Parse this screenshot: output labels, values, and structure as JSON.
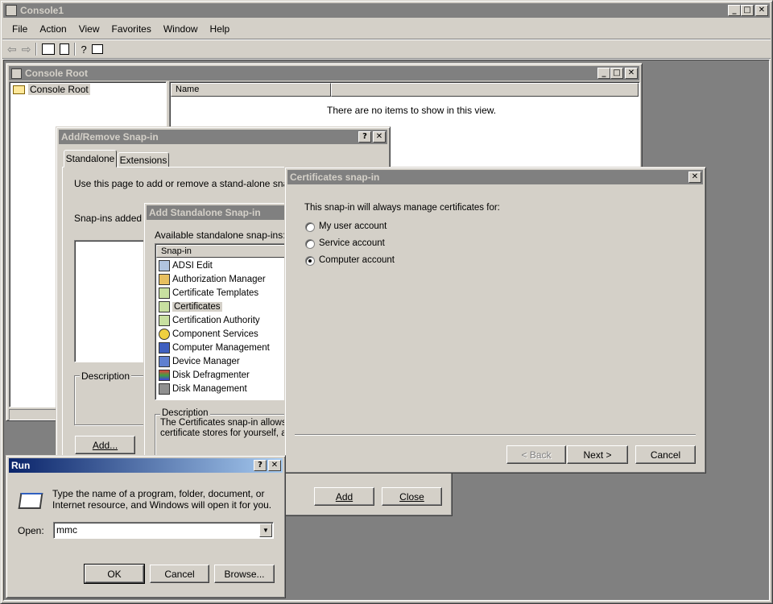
{
  "console": {
    "title": "Console1",
    "menu": [
      "File",
      "Action",
      "View",
      "Favorites",
      "Window",
      "Help"
    ]
  },
  "console_root": {
    "title": "Console Root",
    "tree_item": "Console Root",
    "column_name": "Name",
    "empty_message": "There are no items to show in this view."
  },
  "add_remove": {
    "title": "Add/Remove Snap-in",
    "tabs": [
      "Standalone",
      "Extensions"
    ],
    "instructions": "Use this page to add or remove a stand-alone snap-in",
    "snapins_added": "Snap-ins added to",
    "description_label": "Description",
    "add_button": "Add..."
  },
  "add_standalone": {
    "title": "Add Standalone Snap-in",
    "available_label": "Available standalone snap-ins:",
    "column": "Snap-in",
    "items": [
      {
        "label": "ADSI Edit",
        "icon": "adsi-edit-icon"
      },
      {
        "label": "Authorization Manager",
        "icon": "authorization-manager-icon"
      },
      {
        "label": "Certificate Templates",
        "icon": "certificate-templates-icon"
      },
      {
        "label": "Certificates",
        "icon": "certificates-icon"
      },
      {
        "label": "Certification Authority",
        "icon": "certification-authority-icon"
      },
      {
        "label": "Component Services",
        "icon": "component-services-icon"
      },
      {
        "label": "Computer Management",
        "icon": "computer-management-icon"
      },
      {
        "label": "Device Manager",
        "icon": "device-manager-icon"
      },
      {
        "label": "Disk Defragmenter",
        "icon": "disk-defragmenter-icon"
      },
      {
        "label": "Disk Management",
        "icon": "disk-management-icon"
      }
    ],
    "selected": "Certificates",
    "description_label": "Description",
    "description_line1": "The Certificates snap-in allows y",
    "description_line2": "certificate stores for yourself, a",
    "add_button": "Add",
    "close_button": "Close"
  },
  "certificates": {
    "title": "Certificates snap-in",
    "prompt": "This snap-in will always manage certificates for:",
    "options": [
      "My user account",
      "Service account",
      "Computer account"
    ],
    "selected_option": "Computer account",
    "back_button": "< Back",
    "next_button": "Next >",
    "cancel_button": "Cancel"
  },
  "run": {
    "title": "Run",
    "message_line1": "Type the name of a program, folder, document, or",
    "message_line2": "Internet resource, and Windows will open it for you.",
    "open_label": "Open:",
    "open_value": "mmc",
    "ok_button": "OK",
    "cancel_button": "Cancel",
    "browse_button": "Browse..."
  },
  "colors": {
    "active_title": "#0a246a",
    "inactive_title": "#808080",
    "face": "#d4d0c8"
  }
}
